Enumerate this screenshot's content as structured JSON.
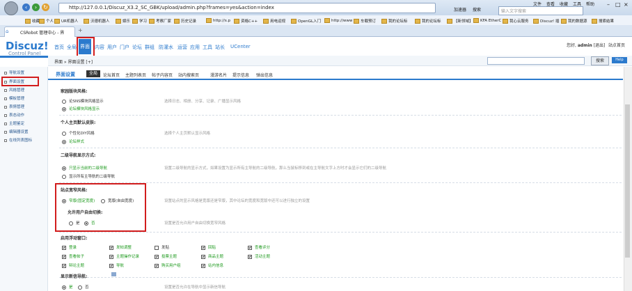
{
  "browser": {
    "url": "http://127.0.0.1/Discuz_X3.2_SC_GBK/upload/admin.php?frames=yes&action=index",
    "search_placeholder": "输入文字搜索",
    "menu": [
      "文件",
      "查看",
      "收藏",
      "工具",
      "帮助"
    ],
    "menu2": [
      "加速器",
      "搜索"
    ],
    "favorites": [
      "收藏",
      "个人",
      "UR机器人",
      "沃德机器人",
      "娱乐",
      "学习",
      "考察厂家",
      "历史记录",
      "http://s.p",
      "资格C++",
      "用电运规",
      "OpenGL入门",
      "http://www",
      "车载预订",
      "我的论坛标",
      "我的论坛标",
      "【新领域】",
      "KFA EtherC",
      "我心云服务",
      "Discuz! 插",
      "我的数据源",
      "搜索结果"
    ],
    "tab_title": "CSRobot 管理中心 - 界"
  },
  "dz": {
    "logo": "Discuz!",
    "logo_sub": "Control Panel",
    "nav": [
      "首页",
      "全局",
      "界面",
      "内容",
      "用户",
      "门户",
      "论坛",
      "群组",
      "防灌水",
      "运营",
      "应用",
      "工具",
      "站长",
      "UCenter"
    ],
    "nav_selected": "界面",
    "user_label": "您好,",
    "user_name": "admin",
    "user_links": "[退出]",
    "site_home": "站点首页",
    "crumb": "界面 » 界面设置  [+]",
    "search_btn": "搜索",
    "search_badge": "Help"
  },
  "sidebar": {
    "items": [
      "导航设置",
      "界面设置",
      "风格管理",
      "模板管理",
      "表情管理",
      "表态动作",
      "主题鉴定",
      "编辑器设置",
      "在线列表图标"
    ]
  },
  "subnav": {
    "title": "界面设置",
    "tabs": [
      "全局",
      "论坛首页",
      "主题列表页",
      "帖子内容页",
      "站内搜索页",
      "漫游名片",
      "提示信息",
      "弹出信息"
    ]
  },
  "sections": {
    "s1": {
      "title": "家园版块风格:",
      "opt1": "论SNS模块风格显示",
      "opt2": "论坛模块风格显示",
      "desc": "选择日志、相册、分享、记录、广播显示风格"
    },
    "s2": {
      "title": "个人主页默认皮肤:",
      "opt1": "个性化DIY风格",
      "opt2": "论坛样式",
      "desc": "选择个人主页默认显示风格"
    },
    "s3": {
      "title": "二级导航显示方式:",
      "opt1": "只显示当前的二级导航",
      "opt2": "显示所有主导航的二级导航",
      "desc": "设置二级导航的显示方式，如果设置为显示所有主导航的二级导航，那么当鼠标移到或在主导航文字上方时才会显示它们的二级导航"
    },
    "s4": {
      "title": "站点宽窄风格:",
      "opt1": "窄版(固定宽度)",
      "opt2": "宽版(自由宽度)",
      "desc": "设置站点的显示风格是宽版还是窄版，其中论坛的宽度和宽版中还可以进行独立的设置"
    },
    "s5": {
      "title": "允许用户自由切换:",
      "opt1": "是",
      "opt2": "否",
      "desc": "设置是否允许用户自由切换宽窄风格"
    },
    "s6": {
      "title": "启用浮动窗口:",
      "desc": ""
    },
    "s7": {
      "title": "显示新信导航:",
      "opt1": "是",
      "opt2": "否",
      "desc": "设置是否允许在导航中显示新信导航"
    }
  },
  "float_checks": [
    {
      "label": "登录",
      "on": true
    },
    {
      "label": "发帖调整",
      "on": true
    },
    {
      "label": "发贴",
      "on": false
    },
    {
      "label": "回贴",
      "on": true
    },
    {
      "label": "查看评分",
      "on": true
    },
    {
      "label": "查看帖子",
      "on": true
    },
    {
      "label": "主题操作记录",
      "on": true
    },
    {
      "label": "投票主题",
      "on": true
    },
    {
      "label": "商品主题",
      "on": true
    },
    {
      "label": "活动主题",
      "on": true
    },
    {
      "label": "辩论主题",
      "on": true
    },
    {
      "label": "导航",
      "on": true
    },
    {
      "label": "购买用户组",
      "on": true
    },
    {
      "label": "站内信息",
      "on": true
    }
  ]
}
